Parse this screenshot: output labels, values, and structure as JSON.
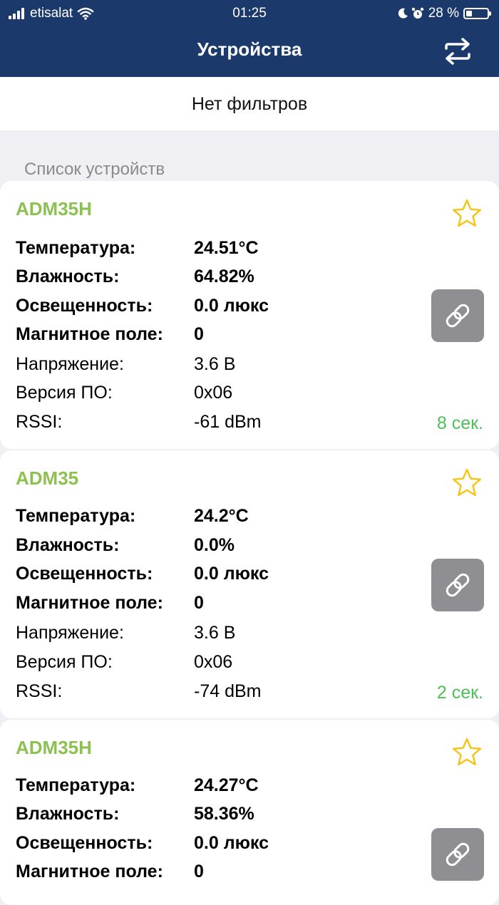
{
  "status_bar": {
    "carrier": "etisalat",
    "time": "01:25",
    "battery": "28 %",
    "battery_level": 0.28
  },
  "nav": {
    "title": "Устройства"
  },
  "filter": {
    "text": "Нет фильтров"
  },
  "section": {
    "title": "Список устройств"
  },
  "colors": {
    "header": "#1b3a6b",
    "device_name": "#8cc152",
    "star": "#f5c518",
    "age": "#4cbf5a",
    "link_button": "#8e8e93"
  },
  "icons": {
    "swap": "swap-arrows-icon",
    "star": "star-outline-icon",
    "link": "link-icon"
  },
  "devices": [
    {
      "name": "ADM35H",
      "rows": [
        {
          "label": "Температура:",
          "value": "24.51°C",
          "bold": true
        },
        {
          "label": "Влажность:",
          "value": "64.82%",
          "bold": true
        },
        {
          "label": "Освещенность:",
          "value": "0.0 люкс",
          "bold": true
        },
        {
          "label": "Магнитное поле:",
          "value": "0",
          "bold": true
        },
        {
          "label": "Напряжение:",
          "value": "3.6 В",
          "bold": false
        },
        {
          "label": "Версия ПО:",
          "value": "0x06",
          "bold": false
        },
        {
          "label": "RSSI:",
          "value": "-61 dBm",
          "bold": false
        }
      ],
      "age": "8 сек."
    },
    {
      "name": "ADM35",
      "rows": [
        {
          "label": "Температура:",
          "value": "24.2°C",
          "bold": true
        },
        {
          "label": "Влажность:",
          "value": "0.0%",
          "bold": true
        },
        {
          "label": "Освещенность:",
          "value": "0.0 люкс",
          "bold": true
        },
        {
          "label": "Магнитное поле:",
          "value": "0",
          "bold": true
        },
        {
          "label": "Напряжение:",
          "value": "3.6 В",
          "bold": false
        },
        {
          "label": "Версия ПО:",
          "value": "0x06",
          "bold": false
        },
        {
          "label": "RSSI:",
          "value": "-74 dBm",
          "bold": false
        }
      ],
      "age": "2 сек."
    },
    {
      "name": "ADM35H",
      "rows": [
        {
          "label": "Температура:",
          "value": "24.27°C",
          "bold": true
        },
        {
          "label": "Влажность:",
          "value": "58.36%",
          "bold": true
        },
        {
          "label": "Освещенность:",
          "value": "0.0 люкс",
          "bold": true
        },
        {
          "label": "Магнитное поле:",
          "value": "0",
          "bold": true
        }
      ],
      "age": ""
    }
  ]
}
